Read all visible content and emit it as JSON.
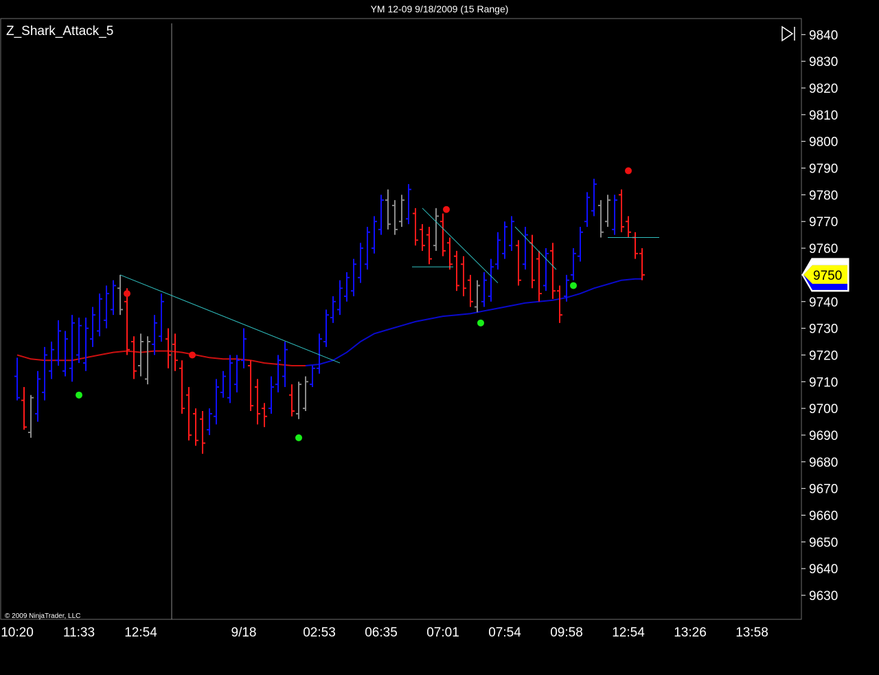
{
  "window": {
    "title": "YM 12-09  9/18/2009 (15 Range)"
  },
  "indicator_label": "Z_Shark_Attack_5",
  "copyright": "© 2009 NinjaTrader, LLC",
  "last_price": "9750",
  "icons": {
    "scroll_end": "skip-to-end-icon"
  },
  "colors": {
    "background": "#000000",
    "up_bar": "#1010ff",
    "down_bar": "#ff1a1a",
    "neutral_bar": "#8c8c8c",
    "moving_average_up": "#0a0acc",
    "moving_average_down": "#cc1010",
    "trend_line": "#30c0c0",
    "buy_dot": "#19ee19",
    "sell_dot": "#ee1111",
    "price_tag": "#ffff00"
  },
  "chart_data": {
    "type": "ohlc",
    "title": "YM 12-09  9/18/2009 (15 Range)",
    "ylim": [
      9621,
      9846
    ],
    "y_ticks": [
      9840,
      9830,
      9820,
      9810,
      9800,
      9790,
      9780,
      9770,
      9760,
      9750,
      9740,
      9730,
      9720,
      9710,
      9700,
      9690,
      9680,
      9670,
      9660,
      9650,
      9640,
      9630
    ],
    "x_tick_labels": [
      "10:20",
      "11:33",
      "12:54",
      "9/18",
      "02:53",
      "06:35",
      "07:01",
      "07:54",
      "09:58",
      "12:54",
      "13:26",
      "13:58"
    ],
    "x_tick_index": [
      0,
      9,
      18,
      33,
      44,
      53,
      62,
      71,
      80,
      89,
      98,
      107
    ],
    "bars": [
      {
        "i": 0,
        "h": 9719,
        "l": 9703,
        "o": 9712,
        "c": 9704,
        "color": "up"
      },
      {
        "i": 1,
        "h": 9708,
        "l": 9692,
        "o": 9703,
        "c": 9693,
        "color": "down"
      },
      {
        "i": 2,
        "h": 9705,
        "l": 9689,
        "o": 9691,
        "c": 9704,
        "color": "neutral"
      },
      {
        "i": 3,
        "h": 9714,
        "l": 9695,
        "o": 9698,
        "c": 9711,
        "color": "up"
      },
      {
        "i": 4,
        "h": 9723,
        "l": 9703,
        "o": 9706,
        "c": 9720,
        "color": "up"
      },
      {
        "i": 5,
        "h": 9725,
        "l": 9711,
        "o": 9714,
        "c": 9722,
        "color": "up"
      },
      {
        "i": 6,
        "h": 9733,
        "l": 9716,
        "o": 9718,
        "c": 9729,
        "color": "up"
      },
      {
        "i": 7,
        "h": 9729,
        "l": 9712,
        "o": 9714,
        "c": 9726,
        "color": "up"
      },
      {
        "i": 8,
        "h": 9735,
        "l": 9710,
        "o": 9715,
        "c": 9732,
        "color": "up"
      },
      {
        "i": 9,
        "h": 9734,
        "l": 9717,
        "o": 9720,
        "c": 9731,
        "color": "up"
      },
      {
        "i": 10,
        "h": 9734,
        "l": 9714,
        "o": 9717,
        "c": 9730,
        "color": "up"
      },
      {
        "i": 11,
        "h": 9738,
        "l": 9723,
        "o": 9726,
        "c": 9735,
        "color": "up"
      },
      {
        "i": 12,
        "h": 9743,
        "l": 9727,
        "o": 9729,
        "c": 9741,
        "color": "up"
      },
      {
        "i": 13,
        "h": 9746,
        "l": 9730,
        "o": 9733,
        "c": 9743,
        "color": "up"
      },
      {
        "i": 14,
        "h": 9748,
        "l": 9735,
        "o": 9737,
        "c": 9746,
        "color": "up"
      },
      {
        "i": 15,
        "h": 9750,
        "l": 9735,
        "o": 9745,
        "c": 9737,
        "color": "neutral"
      },
      {
        "i": 16,
        "h": 9745,
        "l": 9720,
        "o": 9740,
        "c": 9722,
        "color": "down"
      },
      {
        "i": 17,
        "h": 9727,
        "l": 9711,
        "o": 9725,
        "c": 9714,
        "color": "down"
      },
      {
        "i": 18,
        "h": 9728,
        "l": 9712,
        "o": 9716,
        "c": 9725,
        "color": "neutral"
      },
      {
        "i": 19,
        "h": 9727,
        "l": 9709,
        "o": 9711,
        "c": 9725,
        "color": "neutral"
      },
      {
        "i": 20,
        "h": 9735,
        "l": 9720,
        "o": 9724,
        "c": 9732,
        "color": "up"
      },
      {
        "i": 21,
        "h": 9743,
        "l": 9725,
        "o": 9727,
        "c": 9740,
        "color": "up"
      },
      {
        "i": 22,
        "h": 9730,
        "l": 9715,
        "o": 9726,
        "c": 9720,
        "color": "down"
      },
      {
        "i": 23,
        "h": 9728,
        "l": 9714,
        "o": 9724,
        "c": 9718,
        "color": "down"
      },
      {
        "i": 24,
        "h": 9718,
        "l": 9698,
        "o": 9715,
        "c": 9700,
        "color": "down"
      },
      {
        "i": 25,
        "h": 9708,
        "l": 9688,
        "o": 9705,
        "c": 9690,
        "color": "down"
      },
      {
        "i": 26,
        "h": 9700,
        "l": 9686,
        "o": 9698,
        "c": 9688,
        "color": "down"
      },
      {
        "i": 27,
        "h": 9699,
        "l": 9683,
        "o": 9696,
        "c": 9687,
        "color": "down"
      },
      {
        "i": 28,
        "h": 9700,
        "l": 9690,
        "o": 9692,
        "c": 9698,
        "color": "up"
      },
      {
        "i": 29,
        "h": 9711,
        "l": 9694,
        "o": 9697,
        "c": 9708,
        "color": "up"
      },
      {
        "i": 30,
        "h": 9714,
        "l": 9704,
        "o": 9706,
        "c": 9712,
        "color": "up"
      },
      {
        "i": 31,
        "h": 9720,
        "l": 9702,
        "o": 9704,
        "c": 9717,
        "color": "up"
      },
      {
        "i": 32,
        "h": 9720,
        "l": 9706,
        "o": 9709,
        "c": 9718,
        "color": "up"
      },
      {
        "i": 33,
        "h": 9730,
        "l": 9715,
        "o": 9718,
        "c": 9726,
        "color": "up"
      },
      {
        "i": 34,
        "h": 9718,
        "l": 9699,
        "o": 9716,
        "c": 9701,
        "color": "down"
      },
      {
        "i": 35,
        "h": 9711,
        "l": 9694,
        "o": 9708,
        "c": 9698,
        "color": "down"
      },
      {
        "i": 36,
        "h": 9702,
        "l": 9693,
        "o": 9700,
        "c": 9697,
        "color": "down"
      },
      {
        "i": 37,
        "h": 9712,
        "l": 9698,
        "o": 9700,
        "c": 9708,
        "color": "up"
      },
      {
        "i": 38,
        "h": 9720,
        "l": 9706,
        "o": 9709,
        "c": 9718,
        "color": "up"
      },
      {
        "i": 39,
        "h": 9725,
        "l": 9708,
        "o": 9712,
        "c": 9722,
        "color": "up"
      },
      {
        "i": 40,
        "h": 9709,
        "l": 9697,
        "o": 9705,
        "c": 9699,
        "color": "down"
      },
      {
        "i": 41,
        "h": 9710,
        "l": 9696,
        "o": 9698,
        "c": 9709,
        "color": "neutral"
      },
      {
        "i": 42,
        "h": 9712,
        "l": 9699,
        "o": 9700,
        "c": 9710,
        "color": "neutral"
      },
      {
        "i": 43,
        "h": 9716,
        "l": 9708,
        "o": 9709,
        "c": 9715,
        "color": "up"
      },
      {
        "i": 44,
        "h": 9728,
        "l": 9713,
        "o": 9715,
        "c": 9726,
        "color": "up"
      },
      {
        "i": 45,
        "h": 9737,
        "l": 9723,
        "o": 9725,
        "c": 9735,
        "color": "up"
      },
      {
        "i": 46,
        "h": 9742,
        "l": 9732,
        "o": 9734,
        "c": 9740,
        "color": "up"
      },
      {
        "i": 47,
        "h": 9748,
        "l": 9735,
        "o": 9737,
        "c": 9745,
        "color": "up"
      },
      {
        "i": 48,
        "h": 9751,
        "l": 9740,
        "o": 9742,
        "c": 9749,
        "color": "up"
      },
      {
        "i": 49,
        "h": 9756,
        "l": 9742,
        "o": 9744,
        "c": 9754,
        "color": "up"
      },
      {
        "i": 50,
        "h": 9762,
        "l": 9747,
        "o": 9749,
        "c": 9760,
        "color": "up"
      },
      {
        "i": 51,
        "h": 9768,
        "l": 9752,
        "o": 9754,
        "c": 9766,
        "color": "up"
      },
      {
        "i": 52,
        "h": 9772,
        "l": 9758,
        "o": 9760,
        "c": 9770,
        "color": "up"
      },
      {
        "i": 53,
        "h": 9780,
        "l": 9765,
        "o": 9767,
        "c": 9778,
        "color": "up"
      },
      {
        "i": 54,
        "h": 9782,
        "l": 9767,
        "o": 9778,
        "c": 9769,
        "color": "neutral"
      },
      {
        "i": 55,
        "h": 9778,
        "l": 9765,
        "o": 9776,
        "c": 9767,
        "color": "neutral"
      },
      {
        "i": 56,
        "h": 9780,
        "l": 9768,
        "o": 9770,
        "c": 9778,
        "color": "neutral"
      },
      {
        "i": 57,
        "h": 9784,
        "l": 9769,
        "o": 9771,
        "c": 9782,
        "color": "up"
      },
      {
        "i": 58,
        "h": 9775,
        "l": 9761,
        "o": 9773,
        "c": 9763,
        "color": "down"
      },
      {
        "i": 59,
        "h": 9769,
        "l": 9759,
        "o": 9767,
        "c": 9761,
        "color": "down"
      },
      {
        "i": 60,
        "h": 9768,
        "l": 9754,
        "o": 9765,
        "c": 9756,
        "color": "down"
      },
      {
        "i": 61,
        "h": 9775,
        "l": 9759,
        "o": 9761,
        "c": 9772,
        "color": "neutral"
      },
      {
        "i": 62,
        "h": 9773,
        "l": 9757,
        "o": 9770,
        "c": 9759,
        "color": "down"
      },
      {
        "i": 63,
        "h": 9764,
        "l": 9752,
        "o": 9762,
        "c": 9754,
        "color": "down"
      },
      {
        "i": 64,
        "h": 9759,
        "l": 9744,
        "o": 9757,
        "c": 9746,
        "color": "down"
      },
      {
        "i": 65,
        "h": 9757,
        "l": 9742,
        "o": 9754,
        "c": 9745,
        "color": "down"
      },
      {
        "i": 66,
        "h": 9750,
        "l": 9738,
        "o": 9748,
        "c": 9740,
        "color": "down"
      },
      {
        "i": 67,
        "h": 9748,
        "l": 9736,
        "o": 9738,
        "c": 9746,
        "color": "neutral"
      },
      {
        "i": 68,
        "h": 9751,
        "l": 9738,
        "o": 9740,
        "c": 9748,
        "color": "up"
      },
      {
        "i": 69,
        "h": 9756,
        "l": 9740,
        "o": 9742,
        "c": 9753,
        "color": "up"
      },
      {
        "i": 70,
        "h": 9766,
        "l": 9752,
        "o": 9754,
        "c": 9763,
        "color": "up"
      },
      {
        "i": 71,
        "h": 9770,
        "l": 9756,
        "o": 9758,
        "c": 9768,
        "color": "up"
      },
      {
        "i": 72,
        "h": 9772,
        "l": 9759,
        "o": 9761,
        "c": 9770,
        "color": "up"
      },
      {
        "i": 73,
        "h": 9763,
        "l": 9746,
        "o": 9761,
        "c": 9748,
        "color": "down"
      },
      {
        "i": 74,
        "h": 9768,
        "l": 9752,
        "o": 9754,
        "c": 9765,
        "color": "up"
      },
      {
        "i": 75,
        "h": 9765,
        "l": 9745,
        "o": 9762,
        "c": 9748,
        "color": "down"
      },
      {
        "i": 76,
        "h": 9759,
        "l": 9740,
        "o": 9756,
        "c": 9743,
        "color": "down"
      },
      {
        "i": 77,
        "h": 9760,
        "l": 9744,
        "o": 9746,
        "c": 9758,
        "color": "up"
      },
      {
        "i": 78,
        "h": 9762,
        "l": 9741,
        "o": 9759,
        "c": 9744,
        "color": "down"
      },
      {
        "i": 79,
        "h": 9746,
        "l": 9732,
        "o": 9744,
        "c": 9735,
        "color": "down"
      },
      {
        "i": 80,
        "h": 9750,
        "l": 9740,
        "o": 9742,
        "c": 9748,
        "color": "up"
      },
      {
        "i": 81,
        "h": 9760,
        "l": 9748,
        "o": 9750,
        "c": 9758,
        "color": "up"
      },
      {
        "i": 82,
        "h": 9768,
        "l": 9755,
        "o": 9757,
        "c": 9766,
        "color": "up"
      },
      {
        "i": 83,
        "h": 9781,
        "l": 9768,
        "o": 9770,
        "c": 9779,
        "color": "up"
      },
      {
        "i": 84,
        "h": 9786,
        "l": 9772,
        "o": 9774,
        "c": 9784,
        "color": "up"
      },
      {
        "i": 85,
        "h": 9778,
        "l": 9764,
        "o": 9776,
        "c": 9766,
        "color": "neutral"
      },
      {
        "i": 86,
        "h": 9780,
        "l": 9768,
        "o": 9770,
        "c": 9778,
        "color": "neutral"
      },
      {
        "i": 87,
        "h": 9780,
        "l": 9765,
        "o": 9767,
        "c": 9778,
        "color": "up"
      },
      {
        "i": 88,
        "h": 9782,
        "l": 9766,
        "o": 9780,
        "c": 9768,
        "color": "down"
      },
      {
        "i": 89,
        "h": 9772,
        "l": 9764,
        "o": 9770,
        "c": 9766,
        "color": "down"
      },
      {
        "i": 90,
        "h": 9766,
        "l": 9756,
        "o": 9764,
        "c": 9758,
        "color": "down"
      },
      {
        "i": 91,
        "h": 9760,
        "l": 9748,
        "o": 9758,
        "c": 9750,
        "color": "down"
      }
    ],
    "moving_average": [
      {
        "i": 0,
        "v": 9720
      },
      {
        "i": 2,
        "v": 9718.5
      },
      {
        "i": 4,
        "v": 9718
      },
      {
        "i": 6,
        "v": 9718
      },
      {
        "i": 8,
        "v": 9718
      },
      {
        "i": 10,
        "v": 9719
      },
      {
        "i": 12,
        "v": 9720
      },
      {
        "i": 14,
        "v": 9721
      },
      {
        "i": 16,
        "v": 9721.5
      },
      {
        "i": 18,
        "v": 9721
      },
      {
        "i": 20,
        "v": 9721.5
      },
      {
        "i": 22,
        "v": 9721.5
      },
      {
        "i": 24,
        "v": 9721
      },
      {
        "i": 26,
        "v": 9720
      },
      {
        "i": 28,
        "v": 9719
      },
      {
        "i": 30,
        "v": 9718.5
      },
      {
        "i": 32,
        "v": 9718.5
      },
      {
        "i": 34,
        "v": 9718
      },
      {
        "i": 36,
        "v": 9717
      },
      {
        "i": 38,
        "v": 9716.5
      },
      {
        "i": 40,
        "v": 9716
      },
      {
        "i": 42,
        "v": 9716
      },
      {
        "i": 44,
        "v": 9716.5
      },
      {
        "i": 46,
        "v": 9718
      },
      {
        "i": 48,
        "v": 9721
      },
      {
        "i": 50,
        "v": 9725
      },
      {
        "i": 52,
        "v": 9728
      },
      {
        "i": 54,
        "v": 9729.5
      },
      {
        "i": 56,
        "v": 9731
      },
      {
        "i": 58,
        "v": 9732.5
      },
      {
        "i": 60,
        "v": 9733.5
      },
      {
        "i": 62,
        "v": 9734.5
      },
      {
        "i": 64,
        "v": 9735
      },
      {
        "i": 66,
        "v": 9735.5
      },
      {
        "i": 68,
        "v": 9736.5
      },
      {
        "i": 70,
        "v": 9737.5
      },
      {
        "i": 72,
        "v": 9738.5
      },
      {
        "i": 74,
        "v": 9739.5
      },
      {
        "i": 76,
        "v": 9740
      },
      {
        "i": 78,
        "v": 9740.5
      },
      {
        "i": 80,
        "v": 9741.5
      },
      {
        "i": 82,
        "v": 9743
      },
      {
        "i": 84,
        "v": 9745
      },
      {
        "i": 86,
        "v": 9746.5
      },
      {
        "i": 88,
        "v": 9748
      },
      {
        "i": 90,
        "v": 9748.5
      },
      {
        "i": 91,
        "v": 9748.5
      }
    ],
    "ma_color_switch_index": 43,
    "sell_signals": [
      {
        "i": 16,
        "v": 9743
      },
      {
        "i": 25.5,
        "v": 9720
      },
      {
        "i": 62.5,
        "v": 9774.5
      },
      {
        "i": 89,
        "v": 9789
      }
    ],
    "buy_signals": [
      {
        "i": 9,
        "v": 9705
      },
      {
        "i": 41,
        "v": 9689
      },
      {
        "i": 67.5,
        "v": 9732
      },
      {
        "i": 81,
        "v": 9746
      }
    ],
    "trend_lines": [
      {
        "i1": 15,
        "v1": 9750,
        "i2": 47,
        "v2": 9717
      },
      {
        "i1": 59,
        "v1": 9775,
        "i2": 70,
        "v2": 9747
      },
      {
        "i1": 72.5,
        "v1": 9768,
        "i2": 78.5,
        "v2": 9752
      },
      {
        "i1": 57.5,
        "v1": 9753,
        "i2": 63.5,
        "v2": 9753
      },
      {
        "i1": 86,
        "v1": 9764,
        "i2": 93.5,
        "v2": 9764
      }
    ],
    "session_break_index": 22.5,
    "last_price": 9750
  }
}
